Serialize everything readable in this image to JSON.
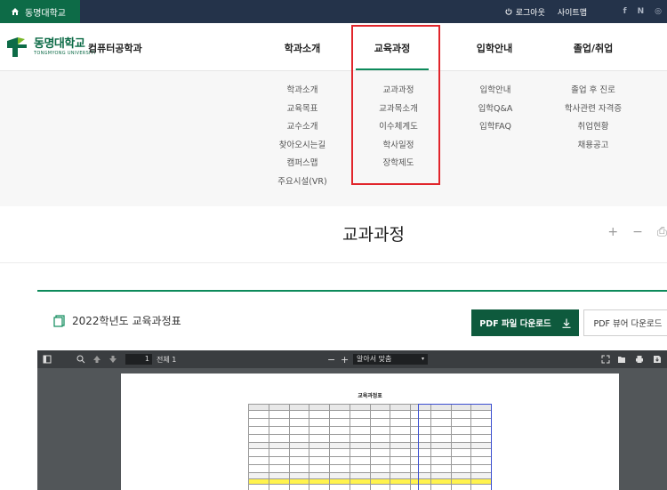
{
  "topbar": {
    "home_label": "동명대학교",
    "logout_label": "로그아웃",
    "sitemap_label": "사이트맵",
    "sns": [
      "f",
      "N",
      "◎"
    ]
  },
  "header": {
    "logo_kor": "동명대학교",
    "logo_eng": "TONGMYONG UNIVERSITY",
    "dept_name": "컴퓨터공학과",
    "gnb": [
      "학과소개",
      "교육과정",
      "입학안내",
      "졸업/취업"
    ]
  },
  "mega_menu": {
    "col1": [
      "학과소개",
      "교육목표",
      "교수소개",
      "찾아오시는길",
      "캠퍼스맵",
      "주요시설(VR)"
    ],
    "col2": [
      "교과과정",
      "교과목소개",
      "이수체계도",
      "학사일정",
      "장학제도"
    ],
    "col3": [
      "입학안내",
      "입학Q&A",
      "입학FAQ"
    ],
    "col4": [
      "졸업 후 진로",
      "학사관련 자격증",
      "취업현황",
      "채용공고"
    ]
  },
  "page": {
    "title": "교과과정",
    "tools": [
      "+",
      "−",
      "⎙"
    ]
  },
  "curriculum": {
    "heading": "2022학년도 교육과정표",
    "pdf_download": "PDF 파일 다운로드",
    "viewer_download": "PDF 뷰어 다운로드"
  },
  "viewer": {
    "page_number": "1",
    "page_total": "전체 1",
    "zoom_label": "알아서 맞춤",
    "doc_title": "교육과정표"
  },
  "colors": {
    "topbar": "#24334a",
    "brand_green": "#0d6b47",
    "highlight_red": "#e1252b"
  }
}
